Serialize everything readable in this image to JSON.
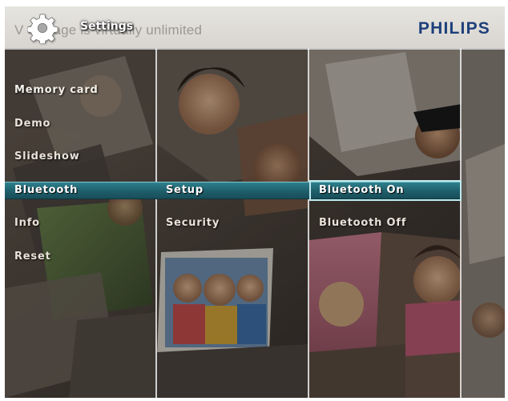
{
  "banner": {
    "title": "Settings",
    "ghost_text": "V  Storage is virtually unlimited",
    "brand": "PHILIPS",
    "icon": "gear-icon"
  },
  "columns": {
    "col1": [
      {
        "label": "Memory card",
        "selected": false
      },
      {
        "label": "Demo",
        "selected": false
      },
      {
        "label": "Slideshow",
        "selected": false
      },
      {
        "label": "Bluetooth",
        "selected": true
      },
      {
        "label": "Info",
        "selected": false
      },
      {
        "label": "Reset",
        "selected": false
      }
    ],
    "col2": [
      {
        "label": "Setup",
        "selected": true
      },
      {
        "label": "Security",
        "selected": false
      }
    ],
    "col3": [
      {
        "label": "Bluetooth On",
        "selected": true
      },
      {
        "label": "Bluetooth Off",
        "selected": false
      }
    ]
  },
  "colors": {
    "brand": "#1e3f7a",
    "selection": "#1f5e6b",
    "selection_outline": "#bfe9ee"
  }
}
